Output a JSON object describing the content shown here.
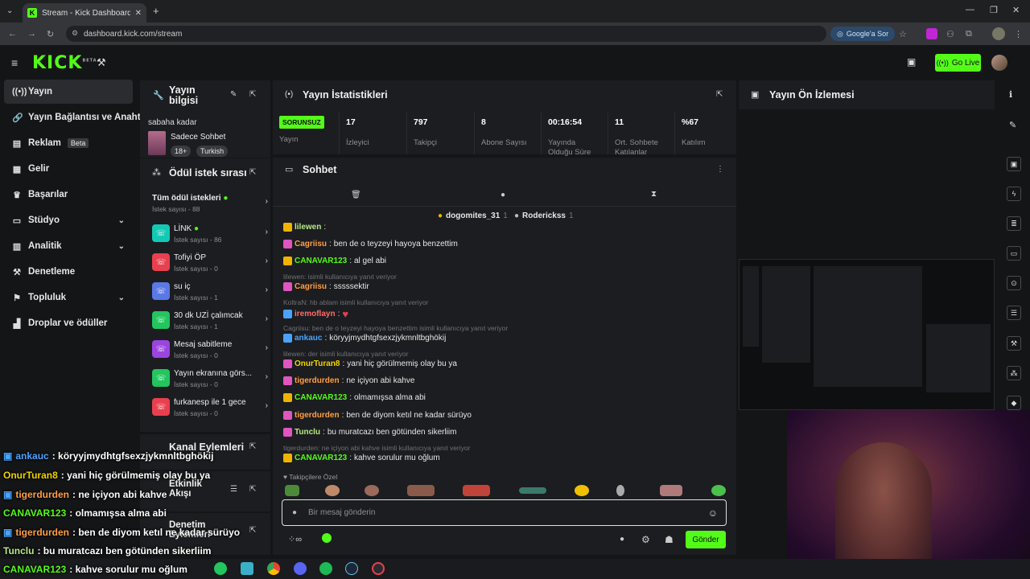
{
  "browser": {
    "tab_title": "Stream - Kick Dashboard",
    "url": "dashboard.kick.com/stream",
    "google_btn": "Google'a Sor"
  },
  "header": {
    "logo": "KICK",
    "logo_sup": "BETA",
    "go_live": "Go Live"
  },
  "sidebar": {
    "items": [
      {
        "label": "Yayın",
        "icon": "broadcast-icon"
      },
      {
        "label": "Yayın Bağlantısı ve Anahtarı",
        "icon": "link-icon"
      },
      {
        "label": "Reklam",
        "icon": "ad-icon",
        "badge": "Beta"
      },
      {
        "label": "Gelir",
        "icon": "revenue-icon"
      },
      {
        "label": "Başarılar",
        "icon": "trophy-icon"
      },
      {
        "label": "Stüdyo",
        "icon": "studio-icon"
      },
      {
        "label": "Analitik",
        "icon": "analytics-icon"
      },
      {
        "label": "Denetleme",
        "icon": "moderation-icon"
      },
      {
        "label": "Topluluk",
        "icon": "community-icon"
      },
      {
        "label": "Droplar ve ödüller",
        "icon": "drops-icon"
      }
    ]
  },
  "stream_info": {
    "title": "Yayın bilgisi",
    "stream_title": "sabaha kadar",
    "category": "Sadece Sohbet",
    "tags": [
      "18+",
      "Turkish"
    ]
  },
  "rewards": {
    "title": "Ödül istek sırası",
    "all_label": "Tüm ödül istekleri",
    "all_count": "İstek sayısı - 88",
    "items": [
      {
        "name": "LİNK",
        "count": "İstek sayısı - 86",
        "color": "#14c9b4"
      },
      {
        "name": "Tofiyi ÖP",
        "count": "İstek sayısı - 0",
        "color": "#e8404f"
      },
      {
        "name": "su iç",
        "count": "İstek sayısı - 1",
        "color": "#5a78e6"
      },
      {
        "name": "30 dk UZİ çalımcak",
        "count": "İstek sayısı - 1",
        "color": "#22c55e"
      },
      {
        "name": "Mesaj sabitleme",
        "count": "İstek sayısı - 0",
        "color": "#9b45e0"
      },
      {
        "name": "Yayın ekranına görs...",
        "count": "İstek sayısı - 0",
        "color": "#22c55e"
      },
      {
        "name": "furkanesp ile 1 gece",
        "count": "İstek sayısı - 0",
        "color": "#e8404f"
      }
    ]
  },
  "channel_actions": {
    "title": "Kanal Eylemleri"
  },
  "activity": {
    "title": "Etkinlik Akışı"
  },
  "moderation": {
    "title": "Denetim Eylemleri"
  },
  "stats": {
    "title": "Yayın İstatistikleri",
    "status": "SORUNSUZ",
    "items": [
      {
        "value": "",
        "label": "Yayın"
      },
      {
        "value": "17",
        "label": "İzleyici"
      },
      {
        "value": "797",
        "label": "Takipçi"
      },
      {
        "value": "8",
        "label": "Abone Sayısı"
      },
      {
        "value": "00:16:54",
        "label": "Yayında Olduğu Süre"
      },
      {
        "value": "11",
        "label": "Ort. Sohbete Katılanlar"
      },
      {
        "value": "%67",
        "label": "Katılım"
      }
    ]
  },
  "chat": {
    "title": "Sohbet",
    "top_users": [
      {
        "name": "dogomites_31",
        "count": "1"
      },
      {
        "name": "Roderickss",
        "count": "1"
      }
    ],
    "messages": [
      {
        "type": "msg",
        "user": "lilewen",
        "text": "",
        "color": "#b8e986",
        "badge": "#f0b400"
      },
      {
        "type": "msg",
        "user": "Cagriisu",
        "text": "ben de o teyzeyi hayoya benzettim",
        "color": "#ff9f43",
        "badge": "#e056c0"
      },
      {
        "type": "msg",
        "user": "CANAVAR123",
        "text": "al gel abi",
        "color": "#53fc18",
        "badge": "#f0b400"
      },
      {
        "type": "reply",
        "text": "lilewen: isimli kullanıcıya yanıt veriyor"
      },
      {
        "type": "msg",
        "user": "Cagriisu",
        "text": "sssssektir",
        "color": "#ff9f43",
        "badge": "#e056c0"
      },
      {
        "type": "reply",
        "text": "KoltraN: hb ablam isimli kullanıcıya yanıt veriyor"
      },
      {
        "type": "msg",
        "user": "iremoflayn",
        "text": "♥",
        "color": "#ff6b6b",
        "badge": "#4aa3ff"
      },
      {
        "type": "reply",
        "text": "Cagriisu: ben de o teyzeyi hayoya benzettim isimli kullanıcıya yanıt veriyor"
      },
      {
        "type": "msg",
        "user": "ankauc",
        "text": "köryyjmydhtgfsexzjykmnltbghökij",
        "color": "#4aa3ff",
        "badge": "#4aa3ff"
      },
      {
        "type": "reply",
        "text": "lilewen: der isimli kullanıcıya yanıt veriyor"
      },
      {
        "type": "msg",
        "user": "OnurTuran8",
        "text": "yani hiç görülmemiş olay bu ya",
        "color": "#f0d400",
        "badge": "#e056c0"
      },
      {
        "type": "msg",
        "user": "tigerdurden",
        "text": "ne içiyon abi kahve",
        "color": "#ff9f43",
        "badge": "#e056c0"
      },
      {
        "type": "msg",
        "user": "CANAVAR123",
        "text": "olmamışsa alma abi",
        "color": "#53fc18",
        "badge": "#f0b400"
      },
      {
        "type": "msg",
        "user": "tigerdurden",
        "text": "ben de diyom ketıl ne kadar sürüyo",
        "color": "#ff9f43",
        "badge": "#e056c0"
      },
      {
        "type": "msg",
        "user": "Tunclu",
        "text": "bu muratcazı ben götünden sikerliim",
        "color": "#b8e986",
        "badge": "#e056c0"
      },
      {
        "type": "reply",
        "text": "tigerdurden: ne içiyon abi kahve isimli kullanıcıya yanıt veriyor"
      },
      {
        "type": "msg",
        "user": "CANAVAR123",
        "text": "kahve sorulur mu oğlum",
        "color": "#53fc18",
        "badge": "#f0b400"
      }
    ],
    "emote_section": "Takipçilere Özel",
    "input_placeholder": "Bir mesaj gönderin",
    "send_label": "Gönder"
  },
  "preview": {
    "title": "Yayın Ön İzlemesi"
  },
  "overlay_chat": [
    {
      "user": "ankauc",
      "text": ": köryyjmydhtgfsexzjykmnltbghökij",
      "color": "#4aa3ff"
    },
    {
      "user": "OnurTuran8",
      "text": ": yani hiç görülmemiş olay bu ya",
      "color": "#f0d400"
    },
    {
      "user": "tigerdurden",
      "text": ": ne içiyon abi kahve",
      "color": "#ff9f43"
    },
    {
      "user": "CANAVAR123",
      "text": ": olmamışsa alma abi",
      "color": "#53fc18"
    },
    {
      "user": "tigerdurden",
      "text": ": ben de diyom ketıl ne kadar sürüyo",
      "color": "#ff9f43"
    },
    {
      "user": "Tunclu",
      "text": ": bu muratcazı ben götünden sikerliim",
      "color": "#b8e986"
    },
    {
      "user": "CANAVAR123",
      "text": ": kahve sorulur mu oğlum",
      "color": "#53fc18"
    }
  ]
}
